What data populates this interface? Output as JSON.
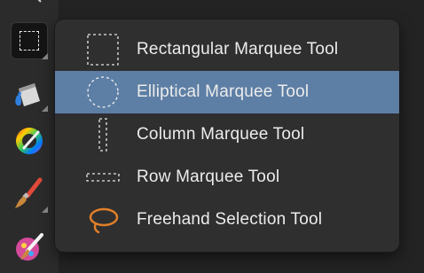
{
  "toolbar": {
    "tools": [
      {
        "name": "marquee-tool",
        "selected": true
      },
      {
        "name": "fill-tool"
      },
      {
        "name": "color-picker-tool"
      },
      {
        "name": "paint-brush-tool"
      },
      {
        "name": "pixel-brush-tool"
      }
    ]
  },
  "menu": {
    "items": [
      {
        "label": "Rectangular Marquee Tool",
        "icon": "rect-marquee-icon",
        "highlighted": false
      },
      {
        "label": "Elliptical Marquee Tool",
        "icon": "ellipse-marquee-icon",
        "highlighted": true
      },
      {
        "label": "Column Marquee Tool",
        "icon": "column-marquee-icon",
        "highlighted": false
      },
      {
        "label": "Row Marquee Tool",
        "icon": "row-marquee-icon",
        "highlighted": false
      },
      {
        "label": "Freehand Selection Tool",
        "icon": "lasso-icon",
        "highlighted": false
      }
    ],
    "highlight_color": "#5d7fa5"
  }
}
